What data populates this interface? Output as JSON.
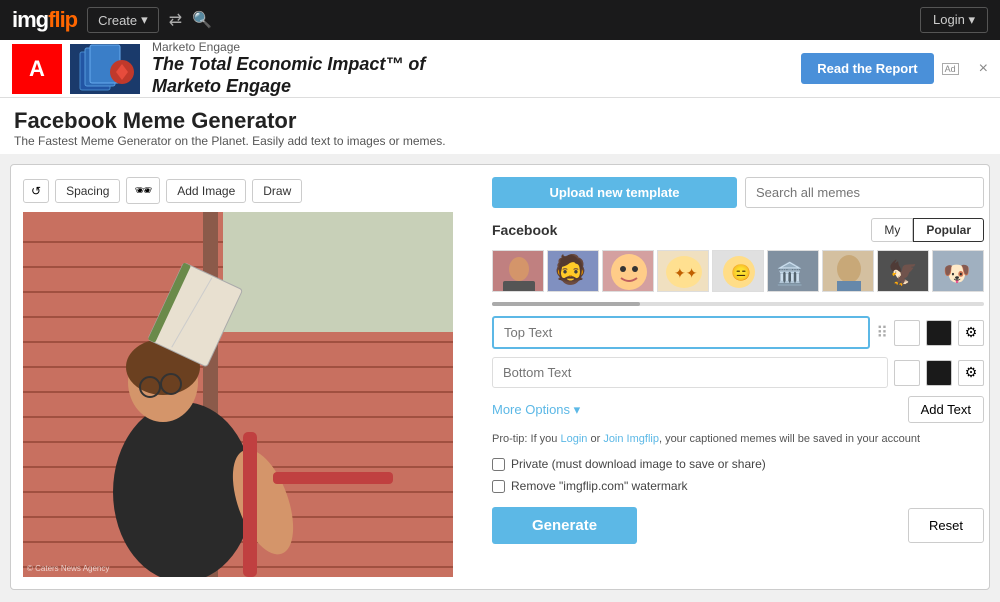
{
  "nav": {
    "logo": "imgflip",
    "logo_flip": "flip",
    "create_label": "Create",
    "login_label": "Login"
  },
  "ad": {
    "brand": "Marketo Engage",
    "headline": "The Total Economic Impact™ of",
    "headline2": "Marketo Engage",
    "cta_label": "Read the Report",
    "badge": "Ad",
    "close": "×"
  },
  "page": {
    "title": "Facebook Meme Generator",
    "subtitle": "The Fastest Meme Generator on the Planet. Easily add text to images or memes."
  },
  "toolbar": {
    "refresh_label": "↺",
    "spacing_label": "Spacing",
    "sunglasses_label": "🕶",
    "add_image_label": "Add Image",
    "draw_label": "Draw"
  },
  "right": {
    "upload_label": "Upload new template",
    "search_placeholder": "Search all memes",
    "filter_label": "Facebook",
    "my_label": "My",
    "popular_label": "Popular",
    "top_text_placeholder": "Top Text",
    "bottom_text_placeholder": "Bottom Text",
    "more_options_label": "More Options ▾",
    "add_text_label": "Add Text",
    "pro_tip_prefix": "Pro-tip: If you ",
    "pro_tip_link1": "Login",
    "pro_tip_mid": " or ",
    "pro_tip_link2": "Join Imgflip",
    "pro_tip_suffix": ", your captioned memes will be saved in your account",
    "private_label": "Private (must download image to save or share)",
    "watermark_label": "Remove \"imgflip.com\" watermark",
    "generate_label": "Generate",
    "reset_label": "Reset"
  },
  "photo_credit": "© Caters News Agency"
}
